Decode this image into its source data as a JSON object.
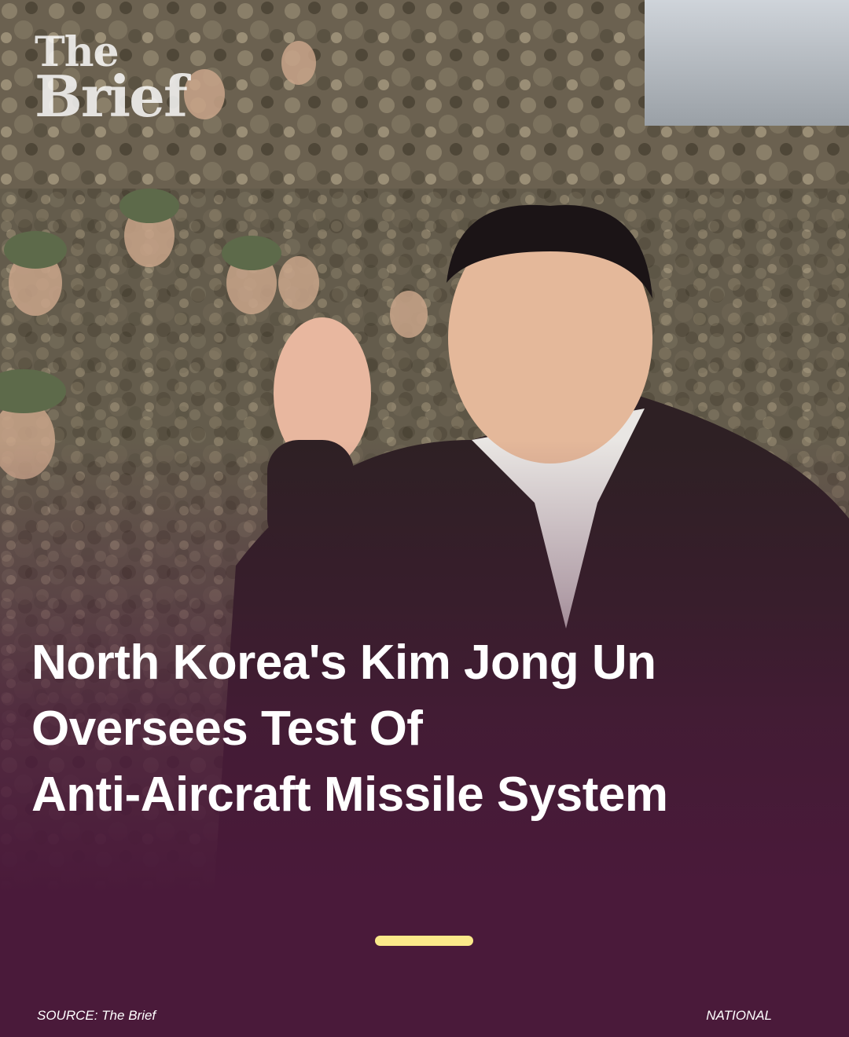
{
  "brand": {
    "logo_line1": "The",
    "logo_line2": "Brief"
  },
  "headline": {
    "line1": "North Korea's Kim Jong Un",
    "line2": "Oversees Test Of",
    "line3": "Anti-Aircraft Missile System"
  },
  "footer": {
    "source": "SOURCE: The Brief",
    "category": "NATIONAL"
  },
  "colors": {
    "background": "#4a1a3a",
    "accent": "#fbe98a",
    "text": "#ffffff"
  }
}
